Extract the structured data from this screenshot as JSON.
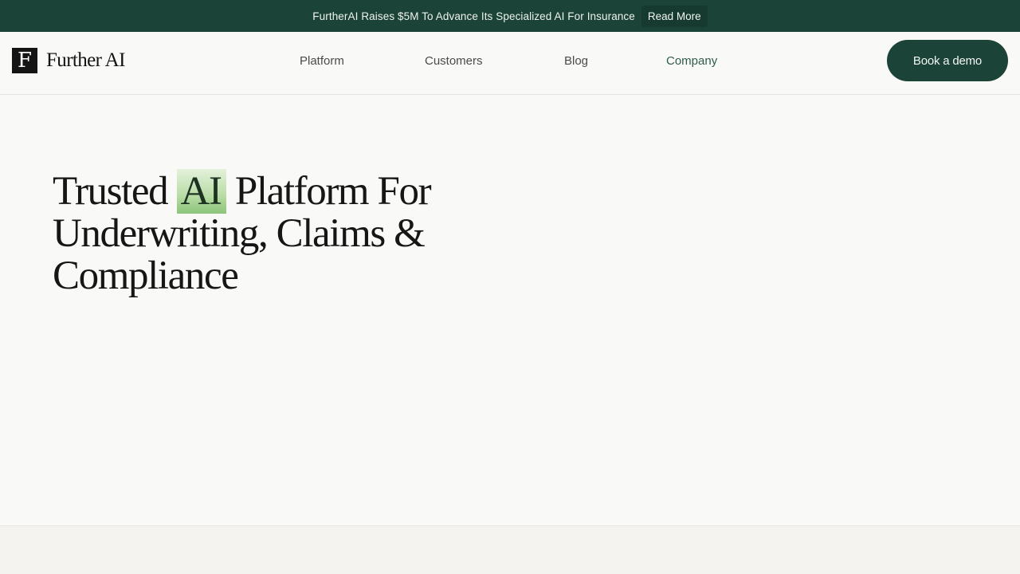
{
  "announcement": {
    "text": "FurtherAI Raises $5M To Advance Its Specialized AI For Insurance",
    "cta": "Read More"
  },
  "brand": {
    "mark": "F",
    "name": "Further AI"
  },
  "nav": {
    "items": [
      "Platform",
      "Customers",
      "Blog",
      "Company"
    ],
    "cta": "Book a demo"
  },
  "hero": {
    "title_before": "Trusted ",
    "title_highlight": "AI",
    "title_after": " Platform For Underwriting, Claims & Compliance"
  },
  "colors": {
    "brand_green": "#1c4337",
    "highlight_green": "#b9dca6",
    "background": "#f9f9f7"
  }
}
